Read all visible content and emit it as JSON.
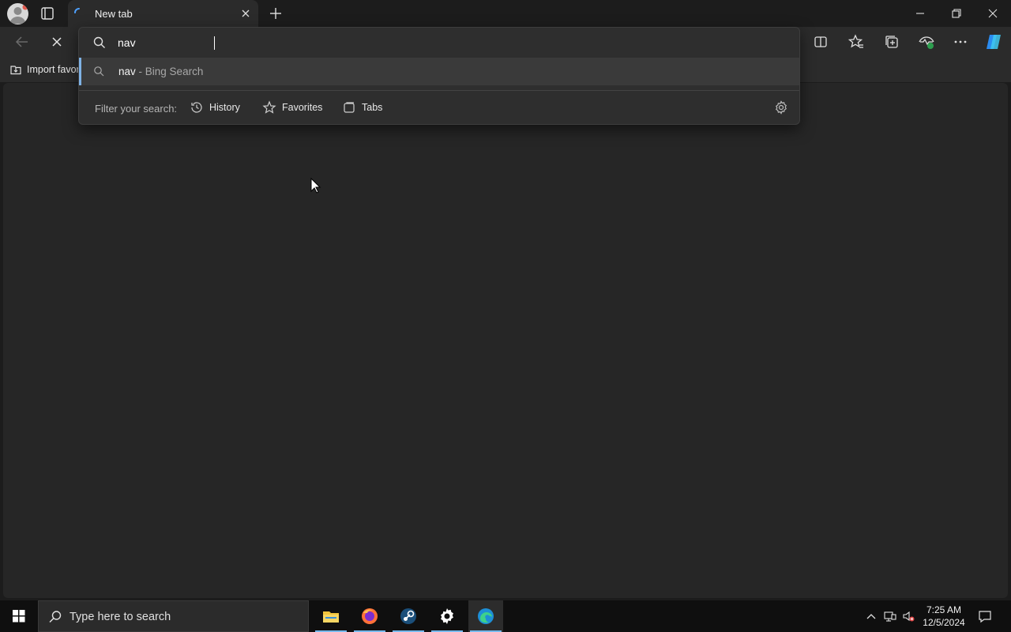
{
  "tab": {
    "title": "New tab"
  },
  "favorites_bar": {
    "import_label": "Import favorites"
  },
  "omnibox": {
    "query": "nav",
    "suggestion": {
      "query": "nav",
      "separator": " - ",
      "source": "Bing Search"
    },
    "filter": {
      "label": "Filter your search:",
      "options": [
        "History",
        "Favorites",
        "Tabs"
      ]
    }
  },
  "taskbar": {
    "search_placeholder": "Type here to search",
    "apps": [
      "file-explorer-icon",
      "firefox-icon",
      "steam-icon",
      "settings-icon",
      "edge-icon"
    ],
    "clock": {
      "time": "7:25 AM",
      "date": "12/5/2024"
    }
  },
  "colors": {
    "chrome_bg": "#1c1c1c",
    "toolbar_bg": "#2b2b2b",
    "page_bg": "#262626",
    "accent": "#7fb2e5",
    "taskbar_bg": "#0f0f0f"
  }
}
